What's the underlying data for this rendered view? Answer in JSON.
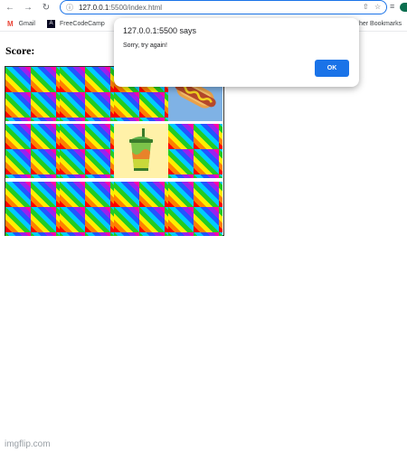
{
  "browser": {
    "url_host": "127.0.0.1",
    "url_port_path": ":5500/index.html",
    "icons": {
      "back": "back-arrow-icon",
      "forward": "forward-arrow-icon",
      "reload": "reload-icon",
      "site_info": "site-info-icon",
      "share": "share-icon",
      "bookmark": "star-icon",
      "reading_list": "reading-list-icon",
      "profile": "profile-avatar"
    },
    "accent_color": "#1a73e8"
  },
  "bookmarks": {
    "items": [
      {
        "label": "Gmail",
        "icon": "gmail-icon"
      },
      {
        "label": "FreeCodeCamp",
        "icon": "freecodecamp-icon"
      }
    ],
    "other_label": "her Bookmarks"
  },
  "page": {
    "score_label": "Score:"
  },
  "game": {
    "rows": 3,
    "cols": 4,
    "card_back": "rainbow-checkered-pattern",
    "cards": [
      {
        "state": "hidden"
      },
      {
        "state": "hidden"
      },
      {
        "state": "hidden"
      },
      {
        "state": "revealed",
        "image": "hotdog-icon"
      },
      {
        "state": "hidden"
      },
      {
        "state": "hidden"
      },
      {
        "state": "revealed",
        "image": "slushie-cup-icon"
      },
      {
        "state": "hidden"
      },
      {
        "state": "hidden"
      },
      {
        "state": "hidden"
      },
      {
        "state": "hidden"
      },
      {
        "state": "hidden"
      }
    ]
  },
  "alert": {
    "title": "127.0.0.1:5500 says",
    "message": "Sorry, try again!",
    "ok_label": "OK"
  },
  "watermark": "imgflip.com"
}
